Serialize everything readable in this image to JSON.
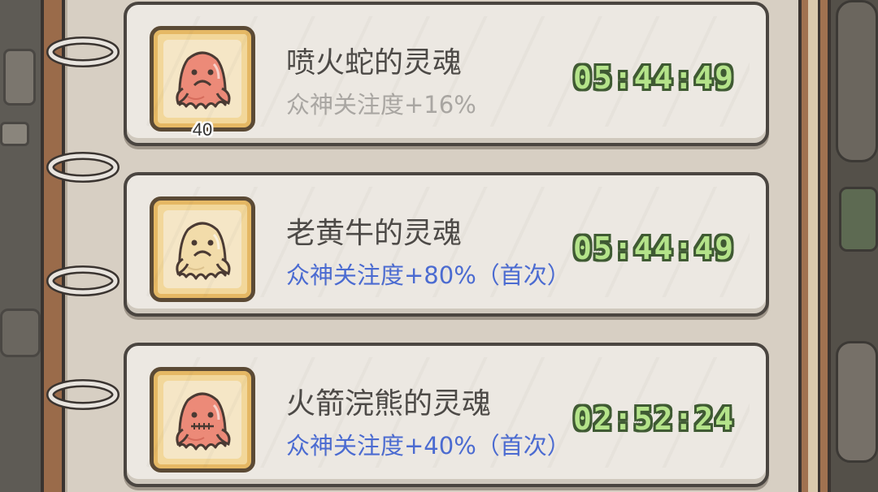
{
  "colors": {
    "bonus_normal": "#a9a6a2",
    "bonus_first": "#4b6bd1",
    "timer_fill": "#b4e38a",
    "timer_outline": "#3f5a33",
    "ghost_red": "#e88070",
    "ghost_cream": "#f0d9a6"
  },
  "souls": [
    {
      "icon": "red-ghost-icon",
      "ghost_color": "#ec8a78",
      "ghost_dark": "#c8584a",
      "count": "40",
      "name": "喷火蛇的灵魂",
      "bonus": "众神关注度+16%",
      "bonus_style": "normal",
      "timer": "05:44:49"
    },
    {
      "icon": "cream-ghost-icon",
      "ghost_color": "#f2dcaa",
      "ghost_dark": "#cdb07a",
      "count": "",
      "name": "老黄牛的灵魂",
      "bonus": "众神关注度+80%（首次）",
      "bonus_style": "first",
      "timer": "05:44:49"
    },
    {
      "icon": "stitched-red-ghost-icon",
      "ghost_color": "#ec8a78",
      "ghost_dark": "#c8584a",
      "count": "",
      "name": "火箭浣熊的灵魂",
      "bonus": "众神关注度+40%（首次）",
      "bonus_style": "first",
      "timer": "02:52:24"
    }
  ]
}
